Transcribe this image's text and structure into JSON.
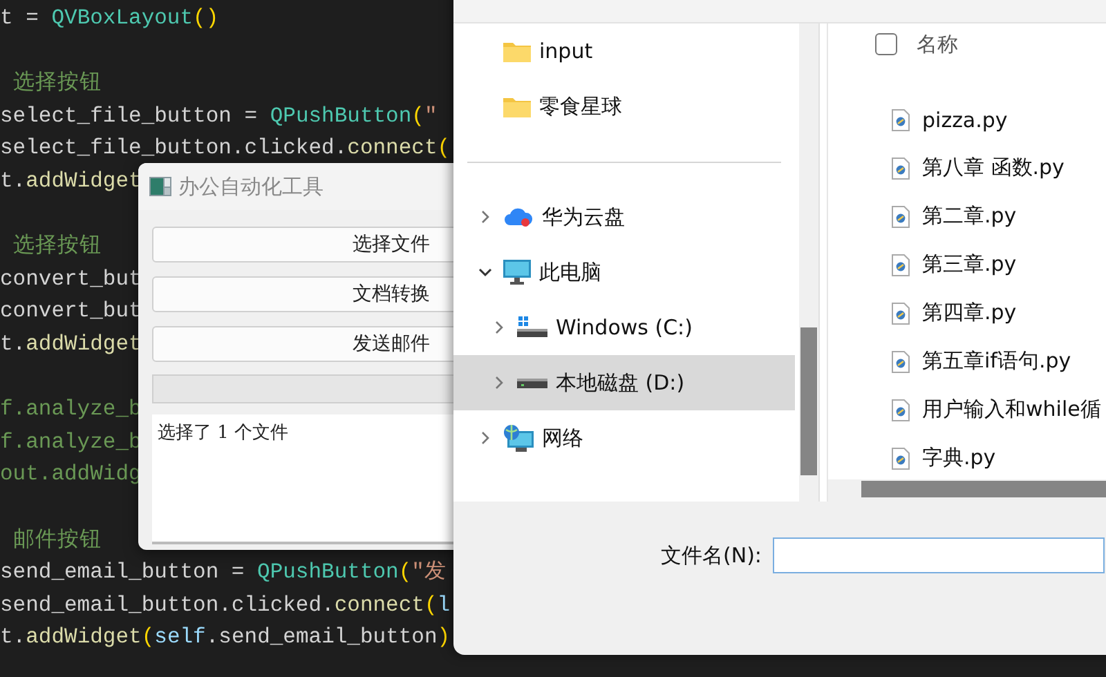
{
  "editor": {
    "lines": [
      {
        "kind": "code",
        "segments": [
          {
            "kind": "plain",
            "text": "t = "
          },
          {
            "kind": "class",
            "text": "QVBoxLayout"
          },
          {
            "kind": "bracket",
            "text": "()"
          }
        ]
      },
      {
        "kind": "blank"
      },
      {
        "kind": "code",
        "segments": [
          {
            "kind": "comment",
            "text": " 选择按钮"
          }
        ]
      },
      {
        "kind": "code",
        "segments": [
          {
            "kind": "plain",
            "text": "select_file_button = "
          },
          {
            "kind": "class",
            "text": "QPushButton"
          },
          {
            "kind": "bracket",
            "text": "("
          },
          {
            "kind": "string",
            "text": "\""
          }
        ]
      },
      {
        "kind": "code",
        "segments": [
          {
            "kind": "plain",
            "text": "select_file_button.clicked."
          },
          {
            "kind": "func",
            "text": "connect"
          },
          {
            "kind": "bracket",
            "text": "("
          }
        ]
      },
      {
        "kind": "code",
        "segments": [
          {
            "kind": "plain",
            "text": "t."
          },
          {
            "kind": "func",
            "text": "addWidget"
          }
        ]
      },
      {
        "kind": "blank"
      },
      {
        "kind": "code",
        "segments": [
          {
            "kind": "comment",
            "text": " 选择按钮"
          }
        ]
      },
      {
        "kind": "code",
        "segments": [
          {
            "kind": "plain",
            "text": "convert_but"
          }
        ]
      },
      {
        "kind": "code",
        "segments": [
          {
            "kind": "plain",
            "text": "convert_but"
          }
        ]
      },
      {
        "kind": "code",
        "segments": [
          {
            "kind": "plain",
            "text": "t."
          },
          {
            "kind": "func",
            "text": "addWidget"
          }
        ]
      },
      {
        "kind": "blank"
      },
      {
        "kind": "code",
        "segments": [
          {
            "kind": "comment",
            "text": "f.analyze_b"
          }
        ]
      },
      {
        "kind": "code",
        "segments": [
          {
            "kind": "comment",
            "text": "f.analyze_b"
          }
        ]
      },
      {
        "kind": "code",
        "segments": [
          {
            "kind": "comment",
            "text": "out.addWidg"
          }
        ]
      },
      {
        "kind": "blank"
      },
      {
        "kind": "code",
        "segments": [
          {
            "kind": "comment",
            "text": " 邮件按钮"
          }
        ]
      },
      {
        "kind": "code",
        "segments": [
          {
            "kind": "plain",
            "text": "send_email_button = "
          },
          {
            "kind": "class",
            "text": "QPushButton"
          },
          {
            "kind": "bracket",
            "text": "("
          },
          {
            "kind": "string",
            "text": "\"发"
          }
        ]
      },
      {
        "kind": "code",
        "segments": [
          {
            "kind": "plain",
            "text": "send_email_button.clicked."
          },
          {
            "kind": "func",
            "text": "connect"
          },
          {
            "kind": "bracket",
            "text": "("
          },
          {
            "kind": "var",
            "text": "l"
          }
        ]
      },
      {
        "kind": "code",
        "segments": [
          {
            "kind": "plain",
            "text": "t."
          },
          {
            "kind": "func",
            "text": "addWidget"
          },
          {
            "kind": "bracket",
            "text": "("
          },
          {
            "kind": "var",
            "text": "self"
          },
          {
            "kind": "plain",
            "text": ".send_email_button"
          },
          {
            "kind": "bracket",
            "text": ")"
          }
        ]
      }
    ]
  },
  "app_window": {
    "title": "办公自动化工具",
    "buttons": [
      "选择文件",
      "文档转换",
      "发送邮件"
    ],
    "progress": {
      "level": 0
    },
    "log": "选择了 1 个文件"
  },
  "file_dialog": {
    "nav": [
      {
        "kind": "folder",
        "label": "input"
      },
      {
        "kind": "folder",
        "label": "零食星球"
      },
      {
        "kind": "separator"
      },
      {
        "kind": "cloud",
        "label": "华为云盘",
        "expanded": false,
        "selected": false
      },
      {
        "kind": "pc",
        "label": "此电脑",
        "expanded": true,
        "selected": false,
        "children": [
          {
            "kind": "windows-drive",
            "label": "Windows (C:)",
            "expanded": false,
            "selected": false
          },
          {
            "kind": "drive",
            "label": "本地磁盘 (D:)",
            "expanded": false,
            "selected": true
          }
        ]
      },
      {
        "kind": "network",
        "label": "网络",
        "expanded": false,
        "selected": false
      }
    ],
    "list_header": {
      "label": "名称",
      "checked": false
    },
    "files": [
      "pizza.py",
      "第八章 函数.py",
      "第二章.py",
      "第三章.py",
      "第四章.py",
      "第五章if语句.py",
      "用户输入和while循",
      "字典.py"
    ],
    "filename_label": "文件名(N):"
  }
}
